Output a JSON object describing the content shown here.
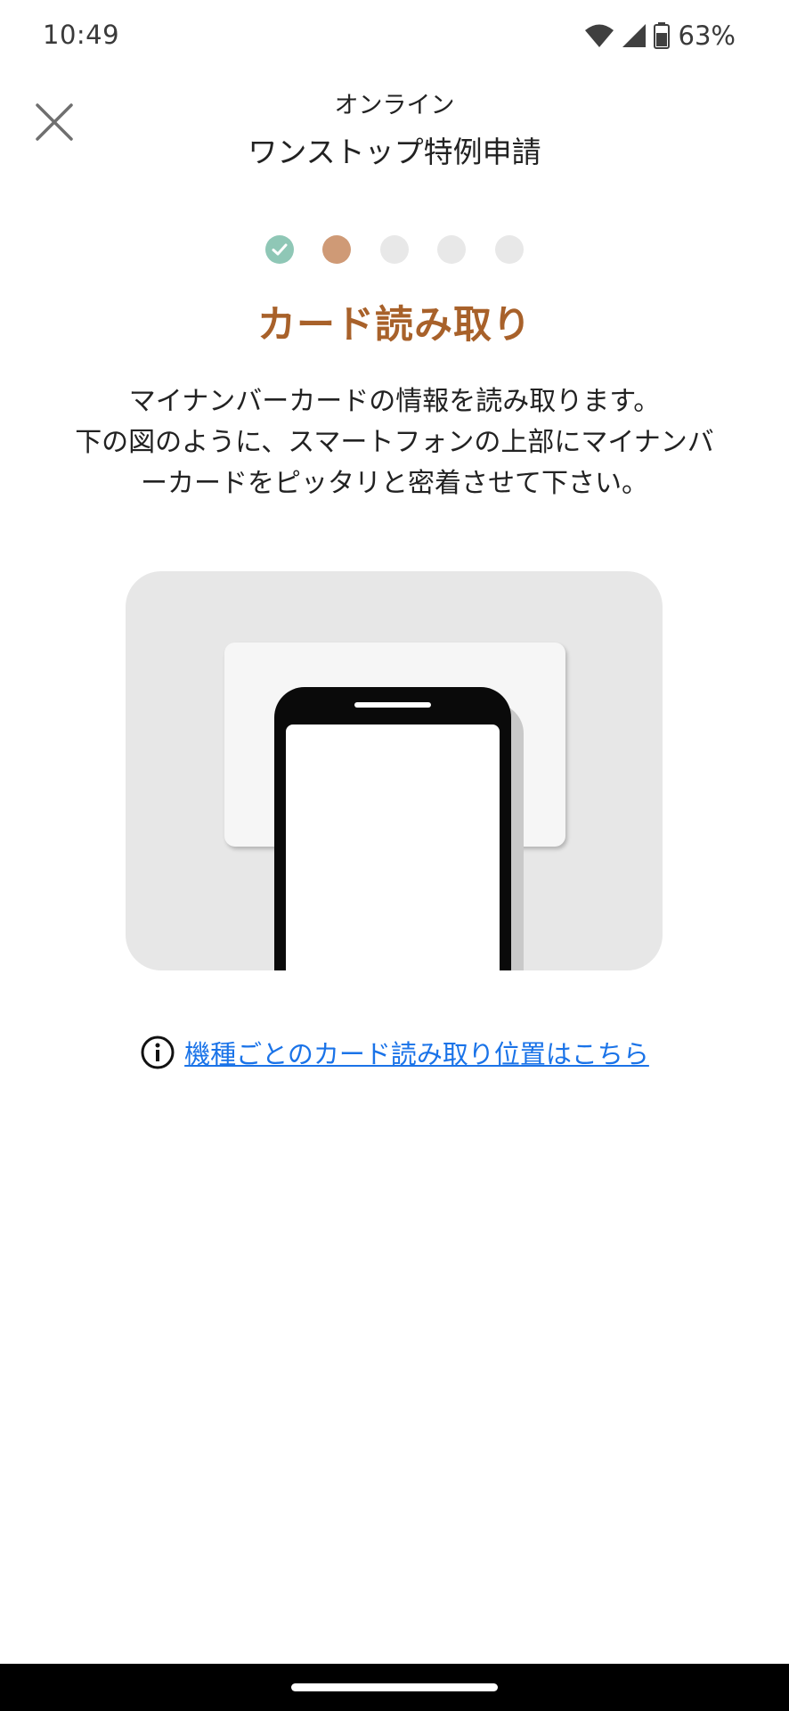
{
  "status_bar": {
    "time": "10:49",
    "battery": "63%",
    "icons": [
      "wifi-icon",
      "cellular-signal-icon",
      "battery-icon"
    ]
  },
  "header": {
    "close_icon": "close-icon",
    "subtitle": "オンライン",
    "title": "ワンストップ特例申請"
  },
  "stepper": {
    "total_steps": 5,
    "current_step": 2,
    "colors": {
      "done": "#8fc7b6",
      "current": "#cf9a76",
      "pending": "#e8e8e8"
    }
  },
  "step": {
    "title": "カード読み取り",
    "title_color": "#a8612a",
    "instructions": [
      "マイナンバーカードの情報を読み取ります。",
      "下の図のように、スマートフォンの上部にマイナンバ",
      "ーカードをピッタリと密着させて下さい。"
    ]
  },
  "illustration": {
    "card": "card-icon",
    "phone": "phone-icon"
  },
  "info": {
    "icon": "info-icon",
    "link_text": "機種ごとのカード読み取り位置はこちら",
    "link_color": "#1a73e8"
  }
}
